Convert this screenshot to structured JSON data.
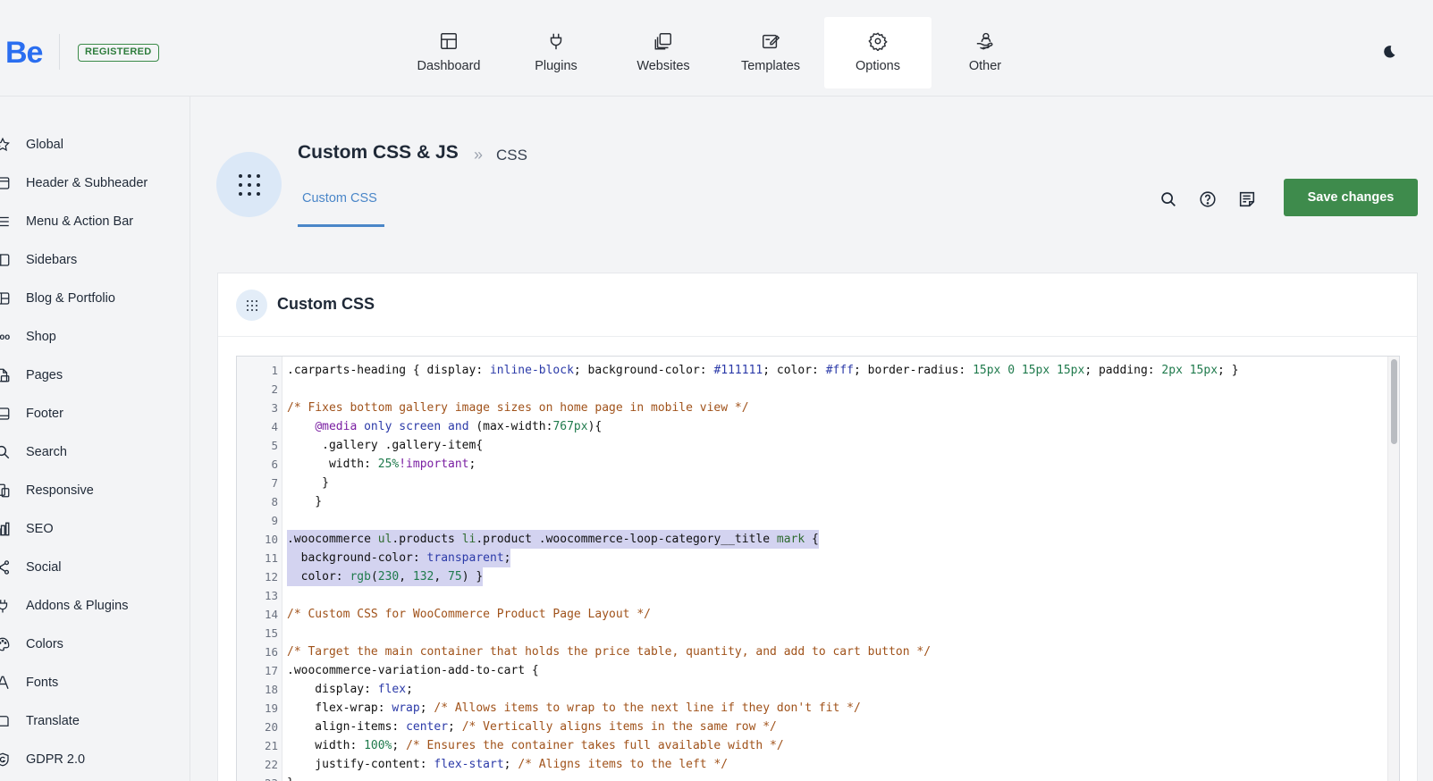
{
  "brand": {
    "logo": "Be",
    "badge": "REGISTERED",
    "accent": "#2a6ef0"
  },
  "nav": [
    {
      "label": "Dashboard",
      "icon": "dashboard-icon",
      "active": false
    },
    {
      "label": "Plugins",
      "icon": "plug-icon",
      "active": false
    },
    {
      "label": "Websites",
      "icon": "websites-icon",
      "active": false
    },
    {
      "label": "Templates",
      "icon": "templates-icon",
      "active": false
    },
    {
      "label": "Options",
      "icon": "gear-icon",
      "active": true
    },
    {
      "label": "Other",
      "icon": "hand-user-icon",
      "active": false
    }
  ],
  "sidebar": {
    "items": [
      {
        "label": "Global",
        "icon": "star-icon"
      },
      {
        "label": "Header & Subheader",
        "icon": "header-icon"
      },
      {
        "label": "Menu & Action Bar",
        "icon": "menu-icon"
      },
      {
        "label": "Sidebars",
        "icon": "sidebar-icon"
      },
      {
        "label": "Blog & Portfolio",
        "icon": "blog-icon"
      },
      {
        "label": "Shop",
        "icon": "woo-icon"
      },
      {
        "label": "Pages",
        "icon": "pages-icon"
      },
      {
        "label": "Footer",
        "icon": "footer-icon"
      },
      {
        "label": "Search",
        "icon": "search-icon"
      },
      {
        "label": "Responsive",
        "icon": "responsive-icon"
      },
      {
        "label": "SEO",
        "icon": "seo-icon"
      },
      {
        "label": "Social",
        "icon": "share-icon"
      },
      {
        "label": "Addons & Plugins",
        "icon": "plug-icon"
      },
      {
        "label": "Colors",
        "icon": "palette-icon"
      },
      {
        "label": "Fonts",
        "icon": "font-icon"
      },
      {
        "label": "Translate",
        "icon": "translate-icon"
      },
      {
        "label": "GDPR 2.0",
        "icon": "gdpr-icon"
      }
    ]
  },
  "page": {
    "title": "Custom CSS & JS",
    "separator": "»",
    "crumb": "CSS",
    "subtab": "Custom CSS",
    "save_label": "Save changes",
    "save_color": "#3e8b4c"
  },
  "card": {
    "title": "Custom CSS"
  },
  "editor": {
    "lines": [
      ".carparts-heading { display: inline-block; background-color: #111111; color: #fff; border-radius: 15px 0 15px 15px; padding: 2px 15px; }",
      "",
      "/* Fixes bottom gallery image sizes on home page in mobile view */",
      "    @media only screen and (max-width:767px){",
      "     .gallery .gallery-item{",
      "      width: 25%!important;",
      "     }",
      "    }",
      "",
      ".woocommerce ul.products li.product .woocommerce-loop-category__title mark {",
      "  background-color: transparent;",
      "  color: rgb(230, 132, 75) }",
      "",
      "/* Custom CSS for WooCommerce Product Page Layout */",
      "",
      "/* Target the main container that holds the price table, quantity, and add to cart button */",
      ".woocommerce-variation-add-to-cart {",
      "    display: flex;",
      "    flex-wrap: wrap; /* Allows items to wrap to the next line if they don't fit */",
      "    align-items: center; /* Vertically aligns items in the same row */",
      "    width: 100%; /* Ensures the container takes full available width */",
      "    justify-content: flex-start; /* Aligns items to the left */",
      "}"
    ]
  }
}
